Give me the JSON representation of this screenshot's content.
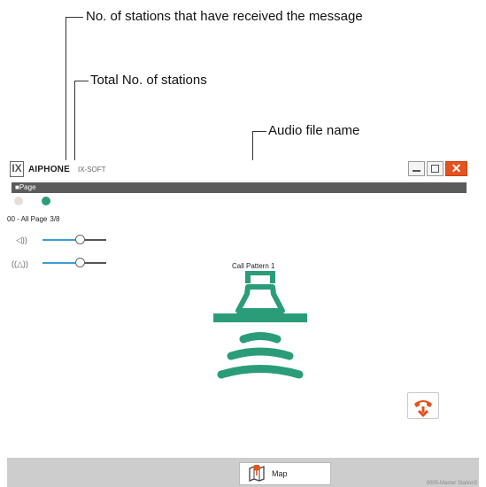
{
  "callouts": {
    "received": "No. of stations that have received the message",
    "total": "Total No. of stations",
    "audio_file": "Audio file name"
  },
  "window": {
    "logo_glyph": "IX",
    "brand": "AIPHONE",
    "product": "IX-SOFT",
    "close_glyph": "✕"
  },
  "page_section": {
    "title": "■Page",
    "group_label": "00 - All Page",
    "station_count": "3/8"
  },
  "volume": {
    "speaker_icon": "◁))",
    "speaker_level": 0.6,
    "mic_icon": "((△))",
    "mic_level": 0.6
  },
  "audio": {
    "file_name": "Call Pattern 1"
  },
  "bottom": {
    "map_label": "Map",
    "station_name": "0005-Master Station3"
  },
  "colors": {
    "accent_green": "#2a9d78",
    "slider_blue": "#3d9ed8",
    "call_end_orange": "#e4521f"
  }
}
